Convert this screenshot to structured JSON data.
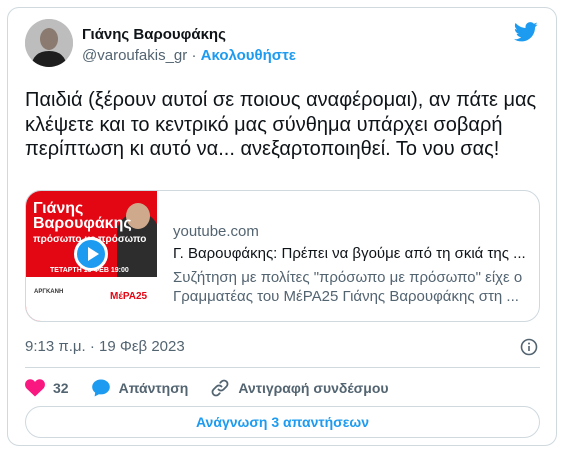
{
  "author": {
    "name": "Γιάνης Βαρουφάκης",
    "handle": "@varoufakis_gr",
    "separator": "·",
    "follow_label": "Ακολουθήστε"
  },
  "tweet": {
    "text": "Παιδιά (ξέρουν αυτοί σε ποιους αναφέρομαι), αν πάτε μας κλέψετε και το κεντρικό μας σύνθημα υπάρχει σοβαρή περίπτωση κι αυτό να... ανεξαρτοποιηθεί. Το νου σας!",
    "timestamp": "9:13 π.μ. · 19 Φεβ 2023"
  },
  "link_card": {
    "domain": "youtube.com",
    "title": "Γ. Βαρουφάκης: Πρέπει να βγούμε από τη σκιά της ...",
    "description": "Συζήτηση με πολίτες \"πρόσωπο με πρόσωπο\" είχε ο Γραμματέας του ΜέΡΑ25 Γιάνης Βαρουφάκης στη ...",
    "thumbnail": {
      "title": "Γιάνης\nΒαρουφάκης",
      "subtitle": "πρόσωπο με πρόσωπο",
      "date": "ΤΕΤΑΡΤΗ 15 ΦΕΒ 19:00",
      "venue": "ΑΡΓΚΑΝΗ",
      "party": "ΜέΡΑ25"
    }
  },
  "actions": {
    "likes": "32",
    "reply_label": "Απάντηση",
    "copy_link_label": "Αντιγραφή συνδέσμου"
  },
  "read_replies_label": "Ανάγνωση 3 απαντήσεων",
  "colors": {
    "accent": "#1d9bf0",
    "like": "#f91880",
    "text": "#0f1419",
    "muted": "#536471",
    "border": "#cfd9de"
  }
}
